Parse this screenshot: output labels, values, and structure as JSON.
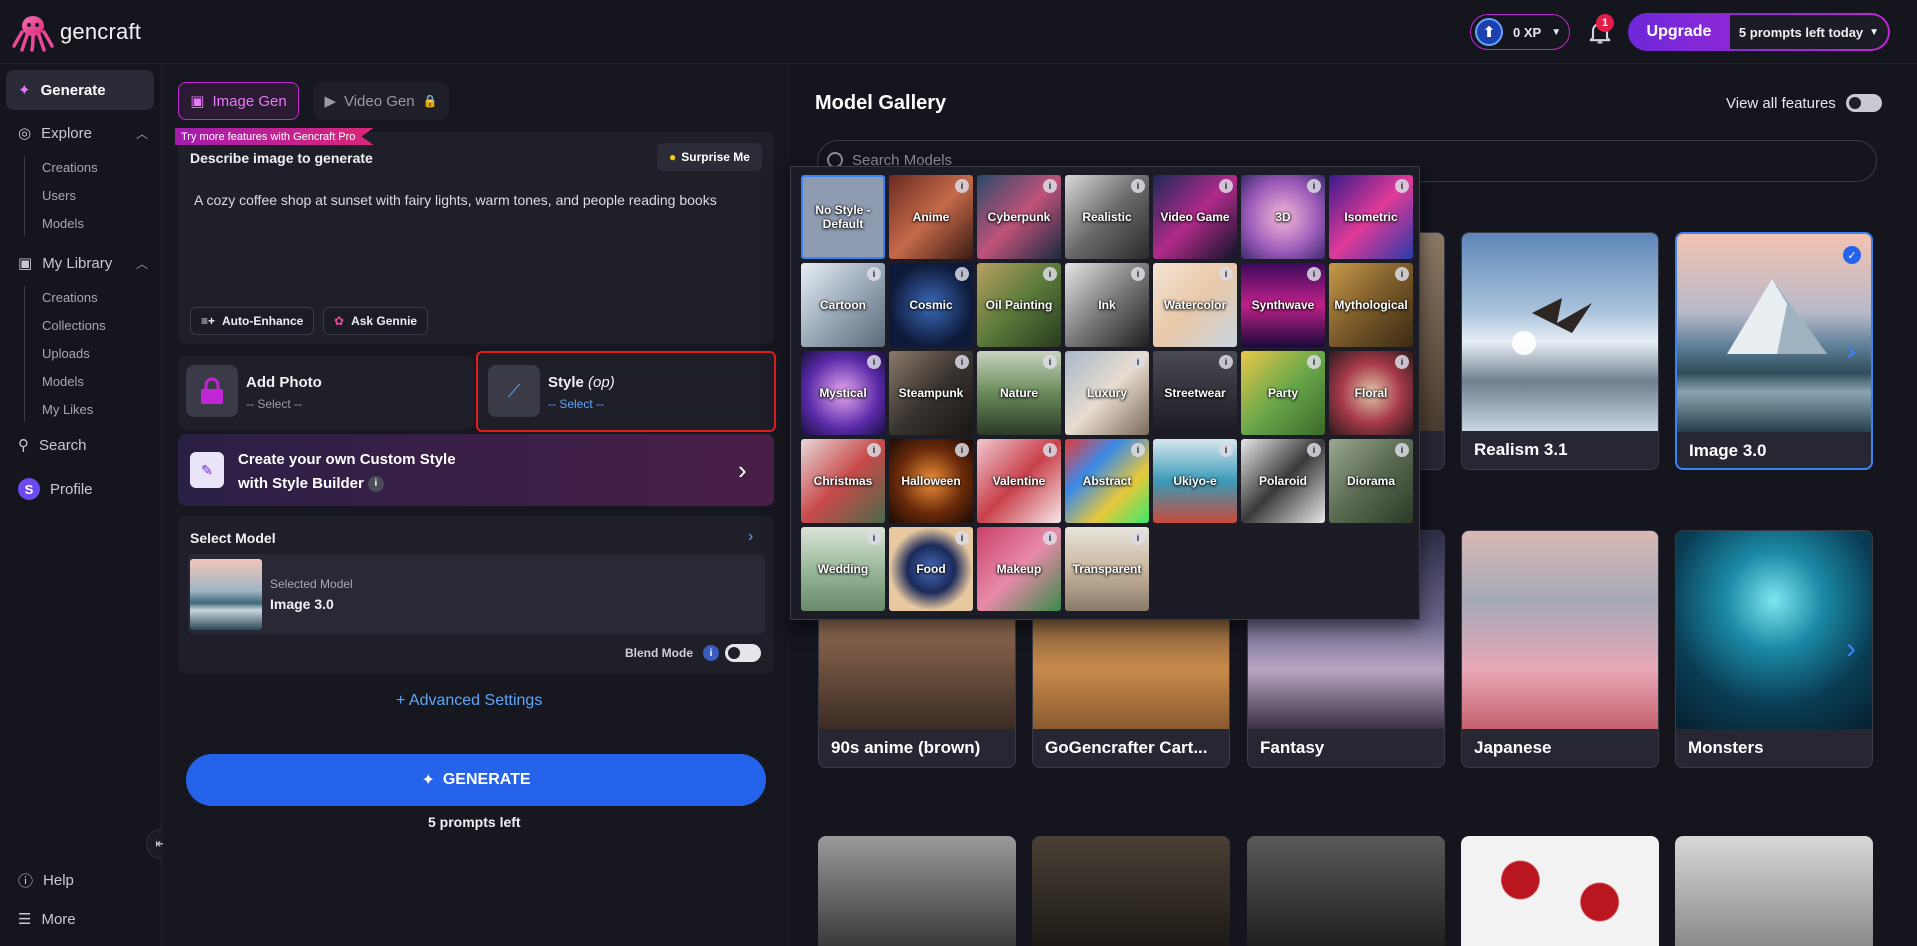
{
  "app": {
    "name": "gencraft"
  },
  "topbar": {
    "xp": "0 XP",
    "notifications": "1",
    "upgrade": "Upgrade",
    "prompts_left": "5 prompts left today"
  },
  "sidebar": {
    "generate": "Generate",
    "explore": "Explore",
    "explore_items": [
      "Creations",
      "Users",
      "Models"
    ],
    "library": "My Library",
    "library_items": [
      "Creations",
      "Collections",
      "Uploads",
      "Models",
      "My Likes"
    ],
    "search": "Search",
    "profile": "Profile",
    "profile_initial": "S",
    "help": "Help",
    "more": "More"
  },
  "left": {
    "tab_image": "Image Gen",
    "tab_video": "Video Gen",
    "pro_ribbon": "Try more features with Gencraft Pro",
    "prompt_title": "Describe image to generate",
    "surprise": "Surprise Me",
    "prompt_text": "A cozy coffee shop at sunset with fairy lights, warm tones, and people reading books",
    "auto_enhance": "Auto-Enhance",
    "ask_gennie": "Ask Gennie",
    "add_photo": "Add Photo",
    "add_photo_sub": "-- Select --",
    "style": "Style",
    "style_op": "(op)",
    "style_sub": "-- Select --",
    "style_builder_line1": "Create your own Custom Style",
    "style_builder_line2": "with Style Builder",
    "select_model": "Select Model",
    "selected_model_label": "Selected Model",
    "selected_model_name": "Image 3.0",
    "blend_mode": "Blend Mode",
    "advanced": "+ Advanced Settings",
    "generate": "GENERATE",
    "prompts_left": "5 prompts left"
  },
  "gallery": {
    "title": "Model Gallery",
    "view_all": "View all features",
    "search_placeholder": "Search Models",
    "row1": [
      "Realism 3.1",
      "Image 3.0"
    ],
    "row2": [
      "90s anime (brown)",
      "GoGencrafter Cart...",
      "Fantasy",
      "Japanese",
      "Monsters"
    ]
  },
  "styles": [
    "No Style - Default",
    "Anime",
    "Cyberpunk",
    "Realistic",
    "Video Game",
    "3D",
    "Isometric",
    "Cartoon",
    "Cosmic",
    "Oil Painting",
    "Ink",
    "Watercolor",
    "Synthwave",
    "Mythological",
    "Mystical",
    "Steampunk",
    "Nature",
    "Luxury",
    "Streetwear",
    "Party",
    "Floral",
    "Christmas",
    "Halloween",
    "Valentine",
    "Abstract",
    "Ukiyo-e",
    "Polaroid",
    "Diorama",
    "Wedding",
    "Food",
    "Makeup",
    "Transparent"
  ],
  "colors": {
    "accent": "#2563eb",
    "brand": "#c026d3",
    "highlight": "#e11d1d"
  }
}
